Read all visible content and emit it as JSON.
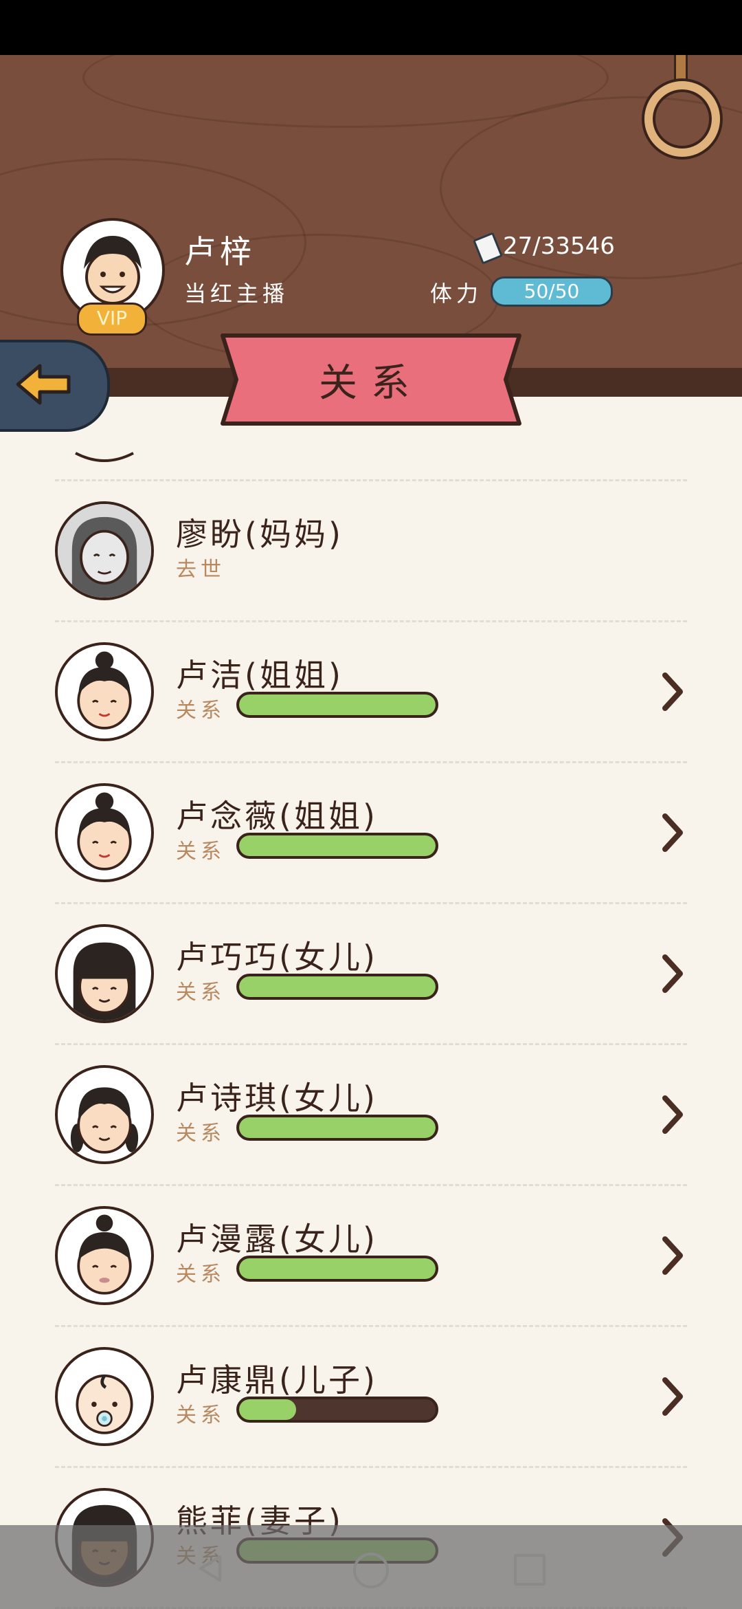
{
  "player": {
    "name": "卢梓",
    "title": "当红主播",
    "vip": "VIP",
    "money": "27/33546",
    "stamina_label": "体力",
    "stamina": "50/50"
  },
  "page": {
    "title": "关系"
  },
  "relations": [
    {
      "name": "廖盼(妈妈)",
      "status": "去世",
      "avatar": "elderly-woman",
      "level": null
    },
    {
      "name": "卢洁(姐姐)",
      "status": "关系",
      "avatar": "woman-bun",
      "level": 1.0
    },
    {
      "name": "卢念薇(姐姐)",
      "status": "关系",
      "avatar": "woman-bun",
      "level": 1.0
    },
    {
      "name": "卢巧巧(女儿)",
      "status": "关系",
      "avatar": "girl-bangs",
      "level": 1.0
    },
    {
      "name": "卢诗琪(女儿)",
      "status": "关系",
      "avatar": "girl-pigtails",
      "level": 1.0
    },
    {
      "name": "卢漫露(女儿)",
      "status": "关系",
      "avatar": "girl-bun",
      "level": 1.0
    },
    {
      "name": "卢康鼎(儿子)",
      "status": "关系",
      "avatar": "baby-pacifier",
      "level": 0.29
    },
    {
      "name": "熊菲(妻子)",
      "status": "关系",
      "avatar": "woman-long-hair",
      "level": 1.0
    }
  ],
  "colors": {
    "header_wood": "#7a4e3c",
    "banner_pink": "#e96f7c",
    "relation_fill": "#97d168",
    "stamina_blue": "#5fbad3",
    "vip_gold": "#f2b23a"
  },
  "icons": {
    "back": "arrow-left-icon",
    "chevron": "chevron-right-icon",
    "money": "paper-note-icon",
    "settings": "ring-icon"
  }
}
